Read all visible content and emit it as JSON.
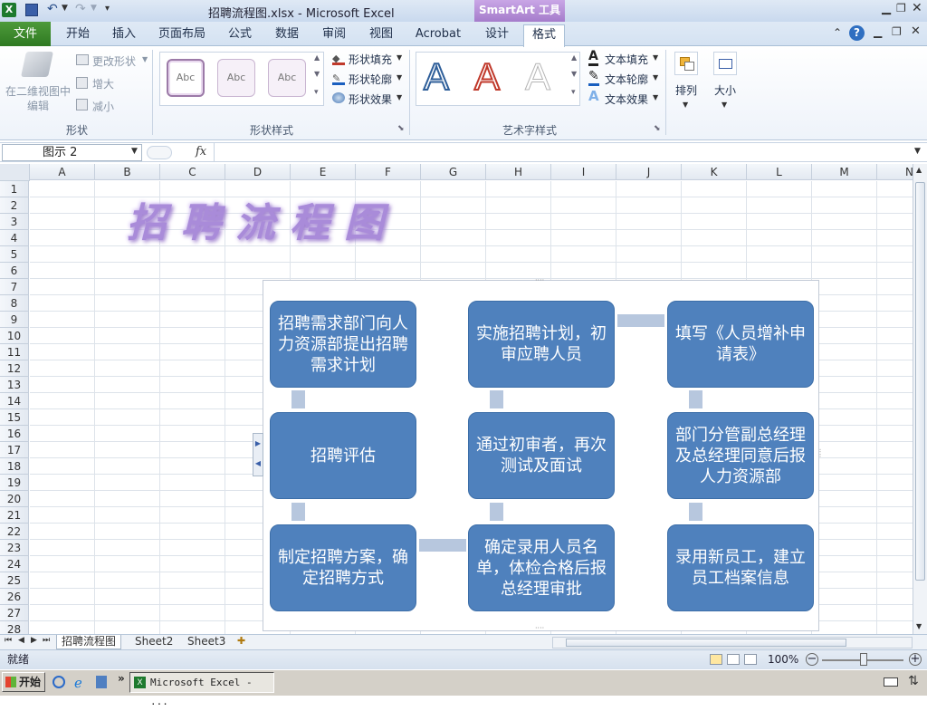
{
  "window": {
    "title": "招聘流程图.xlsx - Microsoft Excel",
    "context_tab": "SmartArt 工具"
  },
  "tabs": {
    "file": "文件",
    "items": [
      "开始",
      "插入",
      "页面布局",
      "公式",
      "数据",
      "审阅",
      "视图",
      "Acrobat",
      "设计",
      "格式"
    ],
    "active": "格式"
  },
  "ribbon": {
    "shape_group": {
      "label": "形状",
      "edit_2d": "在二维视图中编辑",
      "change_shape": "更改形状",
      "larger": "增大",
      "smaller": "减小"
    },
    "shape_styles": {
      "label": "形状样式",
      "gallery": [
        "Abc",
        "Abc",
        "Abc"
      ],
      "fill": "形状填充",
      "outline": "形状轮廓",
      "effects": "形状效果"
    },
    "wordart": {
      "label": "艺术字样式",
      "gallery": [
        "A",
        "A",
        "A"
      ],
      "text_fill": "文本填充",
      "text_outline": "文本轮廓",
      "text_effects": "文本效果"
    },
    "arrange": "排列",
    "size": "大小"
  },
  "formula_bar": {
    "name_box": "图示 2",
    "fx": "fx",
    "value": ""
  },
  "columns": [
    "A",
    "B",
    "C",
    "D",
    "E",
    "F",
    "G",
    "H",
    "I",
    "J",
    "K",
    "L",
    "M",
    "N"
  ],
  "rows": [
    "1",
    "2",
    "3",
    "4",
    "5",
    "6",
    "7",
    "8",
    "9",
    "10",
    "11",
    "12",
    "13",
    "14",
    "15",
    "16",
    "17",
    "18",
    "19",
    "20",
    "21",
    "22",
    "23",
    "24",
    "25",
    "26",
    "27",
    "28"
  ],
  "sheet_title": "招聘流程图",
  "smartart": {
    "boxes": [
      "招聘需求部门向人力资源部提出招聘需求计划",
      "实施招聘计划，初审应聘人员",
      "填写《人员增补申请表》",
      "招聘评估",
      "通过初审者，再次测试及面试",
      "部门分管副总经理及总经理同意后报人力资源部",
      "制定招聘方案，确定招聘方式",
      "确定录用人员名单，体检合格后报总经理审批",
      "录用新员工，建立员工档案信息"
    ]
  },
  "sheets": [
    "招聘流程图",
    "Sheet2",
    "Sheet3"
  ],
  "status": {
    "ready": "就绪",
    "zoom": "100%"
  },
  "taskbar": {
    "start": "开始",
    "window_item": "Microsoft Excel - ..."
  }
}
